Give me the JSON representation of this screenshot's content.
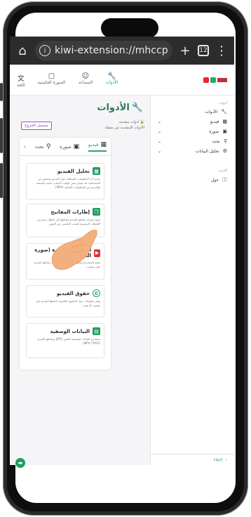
{
  "browser": {
    "url": "kiwi-extension://mhccp",
    "tab_count": "12",
    "icons": [
      "home-icon",
      "info-icon",
      "plus-icon",
      "tabs-icon",
      "menu-icon"
    ]
  },
  "topnav": {
    "items": [
      {
        "label": "الأدوات",
        "active": true
      },
      {
        "label": "المساعد",
        "active": false
      },
      {
        "label": "الصورة العكسية",
        "active": false
      },
      {
        "label": "اللغة",
        "active": false
      }
    ]
  },
  "header": {
    "title": "الأدوات",
    "lock_label": "أدوات متقدمة",
    "subtitle": "الأدوات المتقدمة غير مقفلة",
    "logout_label": "تسجيل الخروج"
  },
  "tabs": [
    {
      "label": "فيديو",
      "active": true
    },
    {
      "label": "صورة",
      "active": false
    },
    {
      "label": "بحث",
      "active": false
    }
  ],
  "cards": [
    {
      "title": "تحليل الفيديو",
      "desc": "يقدم أداء المعلومات السياقية حول الفيديو ويتحقق من المصداقية. قد تحتاج بعض الوقت لأسباب خاصة بالمنصة والفيديو عبر المعلومات الخاصة (MP4)."
    },
    {
      "title": "إطارات المفاتيح",
      "desc": "تقوم بتجزئة مقاطع الفيديو وتحليلها إلى لقطات وتعرض اللقطات الرئيسية للبحث العكسي عن الصور."
    },
    {
      "title": "الصورة المصغرة (صورة الغلاف)",
      "desc": "يقوم باستخراج وإظهار الصور المصغرة من مقاطع الفيديو على يوتيوب."
    },
    {
      "title": "حقوق الفيديو",
      "desc": "يوفر معلومات حول الحقوق القانونية لمقطع الفيديو على يوتيوب أو تويتر."
    },
    {
      "title": "البيانات الوصفية",
      "desc": "يستخرج البيانات الوصفية للصور (JPG) ومقاطع الفيديو (MP4 / MOV)."
    }
  ],
  "sidebar": {
    "section_label": "أدوات",
    "items": [
      {
        "label": "الأدوات",
        "icon": "wrench-icon",
        "expand": false
      },
      {
        "label": "فيديو",
        "icon": "film-icon",
        "expand": true
      },
      {
        "label": "صورة",
        "icon": "image-icon",
        "expand": true
      },
      {
        "label": "بحث",
        "icon": "search-icon",
        "expand": true
      },
      {
        "label": "تحليل البيانات",
        "icon": "data-icon",
        "expand": true
      }
    ],
    "more_label": "المزيد",
    "about_label": "حول",
    "footer_label": "إخفاء"
  }
}
